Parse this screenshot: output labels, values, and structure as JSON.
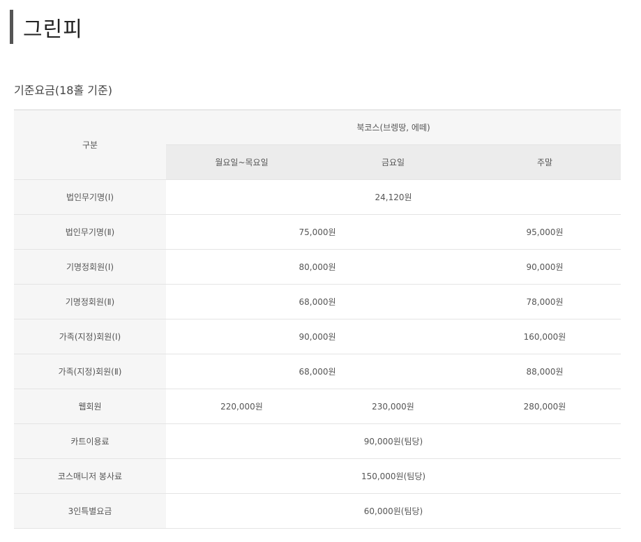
{
  "page": {
    "title": "그린피"
  },
  "section": {
    "title": "기준요금(18홀 기준)"
  },
  "table": {
    "header_category": "구분",
    "header_course": "북코스(브렝땅, 에떼)",
    "header_days": [
      "월요일~목요일",
      "금요일",
      "주말"
    ],
    "rows": [
      {
        "label": "법인무기명(Ⅰ)",
        "all": "24,120원"
      },
      {
        "label": "법인무기명(Ⅱ)",
        "weekday": "75,000원",
        "weekend": "95,000원"
      },
      {
        "label": "기명정회원(Ⅰ)",
        "weekday": "80,000원",
        "weekend": "90,000원"
      },
      {
        "label": "기명정회원(Ⅱ)",
        "weekday": "68,000원",
        "weekend": "78,000원"
      },
      {
        "label": "가족(지정)회원(Ⅰ)",
        "weekday": "90,000원",
        "weekend": "160,000원"
      },
      {
        "label": "가족(지정)회원(Ⅱ)",
        "weekday": "68,000원",
        "weekend": "88,000원"
      },
      {
        "label": "웹회원",
        "mon_thu": "220,000원",
        "fri": "230,000원",
        "weekend": "280,000원"
      },
      {
        "label": "카트이용료",
        "all": "90,000원(팀당)"
      },
      {
        "label": "코스매니저 봉사료",
        "all": "150,000원(팀당)"
      },
      {
        "label": "3인특별요금",
        "all": "60,000원(팀당)"
      }
    ]
  }
}
